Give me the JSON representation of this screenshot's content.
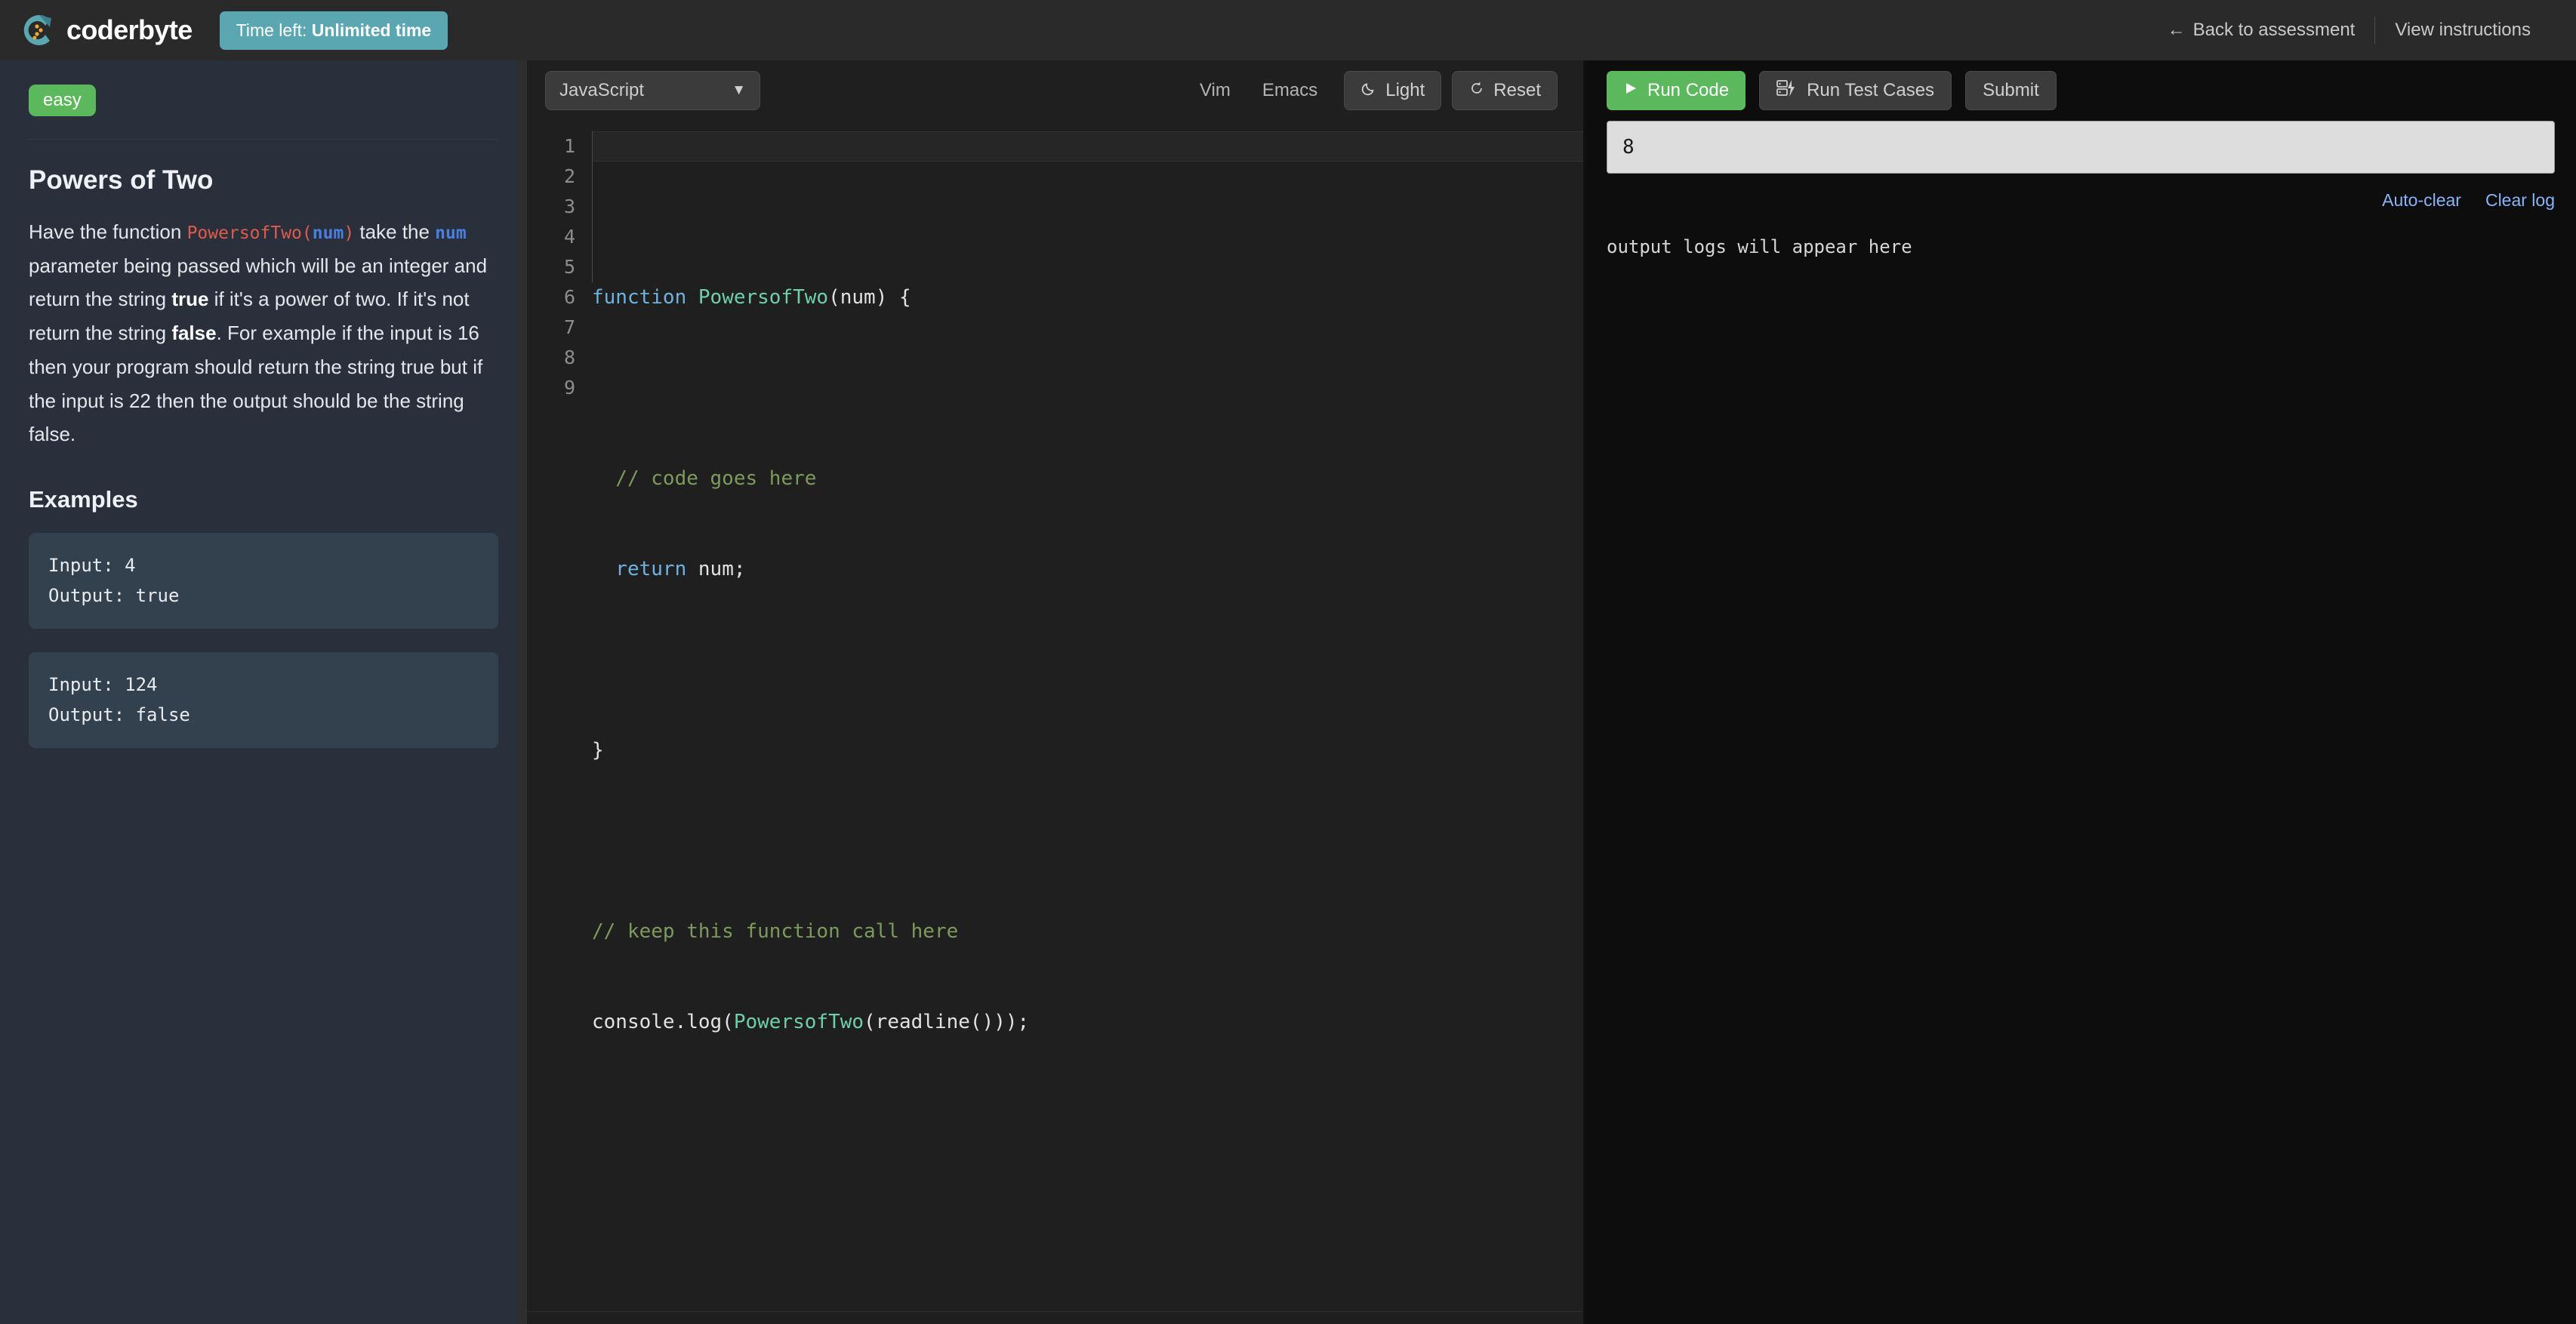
{
  "header": {
    "brand_name": "coderbyte",
    "logo_icon": "coderbyte-logo-icon",
    "timer_prefix": "Time left:",
    "timer_value": "Unlimited time",
    "back_arrow": "←",
    "back_label": "Back to assessment",
    "instructions_label": "View instructions",
    "accent_teal": "#5aa7b2",
    "bg": "#2a2a2a"
  },
  "sidebar": {
    "difficulty_badge": "easy",
    "difficulty_color": "#5cb85c",
    "problem_title": "Powers of Two",
    "description": {
      "p1": "Have the function ",
      "fn_name": "PowersofTwo",
      "paren_open": "(",
      "arg": "num",
      "paren_close": ")",
      "p2": " take the ",
      "arg2": "num",
      "p3": " parameter being passed which will be an integer and return the string ",
      "bold_true": "true",
      "p4": " if it's a power of two. If it's not return the string ",
      "bold_false": "false",
      "p5": ". For example if the input is 16 then your program should return the string true but if the input is 22 then the output should be the string false."
    },
    "examples_heading": "Examples",
    "examples": [
      {
        "input_label": "Input: 4",
        "output_label": "Output: true"
      },
      {
        "input_label": "Input: 124",
        "output_label": "Output: false"
      }
    ]
  },
  "editor": {
    "language": "JavaScript",
    "caret_icon": "chevron-down-icon",
    "vim_label": "Vim",
    "emacs_label": "Emacs",
    "theme_toggle_label": "Light",
    "theme_toggle_icon": "moon-icon",
    "reset_label": "Reset",
    "reset_icon": "refresh-icon",
    "line_numbers": [
      "1",
      "2",
      "3",
      "4",
      "5",
      "6",
      "7",
      "8",
      "9"
    ],
    "code": {
      "l1_kw": "function",
      "l1_fn": " PowersofTwo",
      "l1_rest": "(num) {",
      "l3_comment": "  // code goes here",
      "l4_kw": "  return",
      "l4_rest": " num;",
      "l6": "}",
      "l8_comment": "// keep this function call here",
      "l9_a": "console.log(",
      "l9_fn": "PowersofTwo",
      "l9_b": "(readline()));"
    }
  },
  "output": {
    "run_code_label": "Run Code",
    "run_code_icon": "play-icon",
    "run_tests_label": "Run Test Cases",
    "run_tests_icon": "test-cases-icon",
    "submit_label": "Submit",
    "stdin_value": "8",
    "stdin_placeholder": "",
    "auto_clear_label": "Auto-clear",
    "clear_log_label": "Clear log",
    "log_placeholder": "output logs will appear here"
  }
}
